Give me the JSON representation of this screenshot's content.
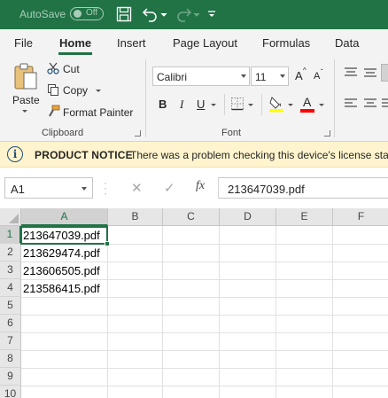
{
  "titlebar": {
    "autosave_label": "AutoSave",
    "autosave_state": "Off",
    "icons": [
      "save-icon",
      "undo-icon",
      "redo-icon",
      "customize-qat-icon"
    ],
    "accent_color": "#217346"
  },
  "tabs": [
    "File",
    "Home",
    "Insert",
    "Page Layout",
    "Formulas",
    "Data"
  ],
  "active_tab": "Home",
  "clipboard": {
    "paste_label": "Paste",
    "cut_label": "Cut",
    "copy_label": "Copy",
    "format_painter_label": "Format Painter",
    "group_label": "Clipboard"
  },
  "font": {
    "font_name": "Calibri",
    "font_size": "11",
    "bold": "B",
    "italic": "I",
    "underline": "U",
    "grow": "A",
    "shrink": "A",
    "group_label": "Font",
    "highlight_color": "#ffff00",
    "font_color": "#ff0000"
  },
  "notice": {
    "title": "PRODUCT NOTICE",
    "message": "There was a problem checking this device's license status"
  },
  "formula_bar": {
    "name_box": "A1",
    "cancel_symbol": "✕",
    "enter_symbol": "✓",
    "fx_symbol": "fx",
    "value": "213647039.pdf"
  },
  "sheet": {
    "columns": [
      "A",
      "B",
      "C",
      "D",
      "E",
      "F"
    ],
    "rows": [
      "1",
      "2",
      "3",
      "4",
      "5",
      "6",
      "7",
      "8",
      "9",
      "10"
    ],
    "cells": [
      "213647039.pdf",
      "213629474.pdf",
      "213606505.pdf",
      "213586415.pdf"
    ],
    "active_cell": "A1"
  }
}
